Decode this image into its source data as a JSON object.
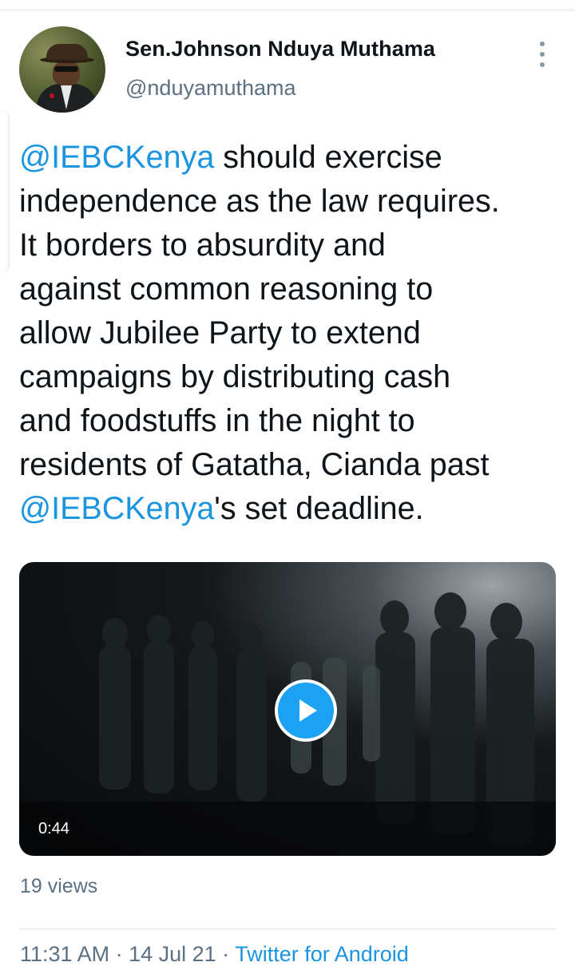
{
  "author": {
    "name": "Sen.Johnson Nduya Muthama",
    "handle": "@nduyamuthama"
  },
  "tweet": {
    "lines": [
      {
        "mention": "@IEBCKenya",
        "text": " should exercise"
      },
      {
        "text": "independence as the law requires."
      },
      {
        "text": "It borders to absurdity and"
      },
      {
        "text": "against common reasoning to"
      },
      {
        "text": "allow Jubilee Party to extend"
      },
      {
        "text": "campaigns by distributing cash"
      },
      {
        "text": "and foodstuffs in the night to"
      },
      {
        "text": "residents of Gatatha, Cianda past"
      },
      {
        "mention": "@IEBCKenya",
        "text": "'s set deadline."
      }
    ]
  },
  "video": {
    "duration": "0:44",
    "views": "19 views"
  },
  "meta": {
    "time": "11:31 AM",
    "separator": " · ",
    "date": "14 Jul 21",
    "source": "Twitter for Android"
  },
  "icons": {
    "more": "more-vertical-icon",
    "play": "play-icon"
  },
  "colors": {
    "mention": "#1b95e0",
    "secondary_text": "#5b7083",
    "play_button": "#1da1f2"
  }
}
